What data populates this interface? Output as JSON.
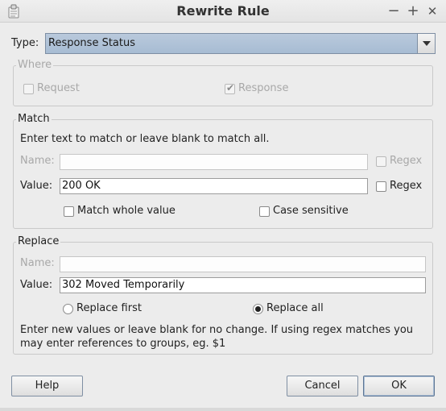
{
  "window": {
    "title": "Rewrite Rule",
    "controls": {
      "minimize": "−",
      "maximize": "+",
      "close": "✕"
    }
  },
  "type": {
    "label": "Type:",
    "selected": "Response Status"
  },
  "where": {
    "legend": "Where",
    "request": {
      "label": "Request",
      "checked": false
    },
    "response": {
      "label": "Response",
      "checked": true
    }
  },
  "match": {
    "legend": "Match",
    "instructions": "Enter text to match or leave blank to match all.",
    "name": {
      "label": "Name:",
      "value": "",
      "regex_label": "Regex"
    },
    "value": {
      "label": "Value:",
      "value": "200 OK",
      "regex_label": "Regex"
    },
    "match_whole_value": "Match whole value",
    "case_sensitive": "Case sensitive"
  },
  "replace": {
    "legend": "Replace",
    "name": {
      "label": "Name:",
      "value": ""
    },
    "value": {
      "label": "Value:",
      "value": "302 Moved Temporarily"
    },
    "replace_first": "Replace first",
    "replace_all": "Replace all",
    "selected": "replace_all",
    "instructions_line1": "Enter new values or leave blank for no change. If using regex matches you",
    "instructions_line2": "may enter references to groups, eg. $1"
  },
  "buttons": {
    "help": "Help",
    "cancel": "Cancel",
    "ok": "OK"
  }
}
